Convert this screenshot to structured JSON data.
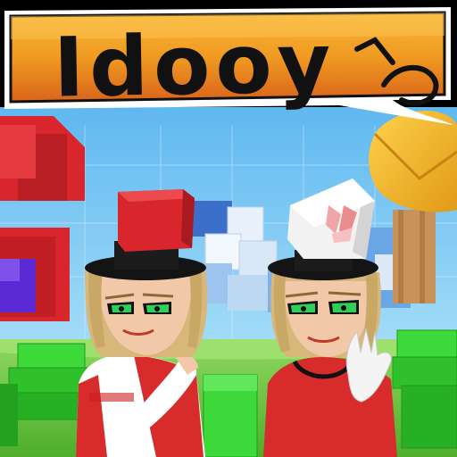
{
  "banner": {
    "title": "Idooy",
    "colors": {
      "banner_orange": "#f0a020",
      "banner_dark": "#d05a10",
      "outline": "#111111",
      "border": "#ffffff"
    }
  },
  "scene": {
    "colors": {
      "sky": "#8ed0f5",
      "sky_light": "#c9ebfb",
      "ground": "#6cc83c",
      "block_red": "#d8262c",
      "block_green": "#3ed93a",
      "block_blue": "#3e7be0",
      "block_white": "#eef4fb",
      "block_purple": "#5b2ad4",
      "hat_black": "#141414",
      "skin": "#f1c9a8",
      "hair": "#d7b77a",
      "shirt_red": "#d82c2c",
      "eye_green": "#2fd05a",
      "tree_yellow": "#f3b52a",
      "tree_trunk": "#c9925a"
    },
    "characters": [
      {
        "id": "left",
        "hat": "top-hat-red-block",
        "pose": "arm-across-chest"
      },
      {
        "id": "right",
        "hat": "top-hat-white-block",
        "pose": "hand-wave"
      }
    ]
  }
}
